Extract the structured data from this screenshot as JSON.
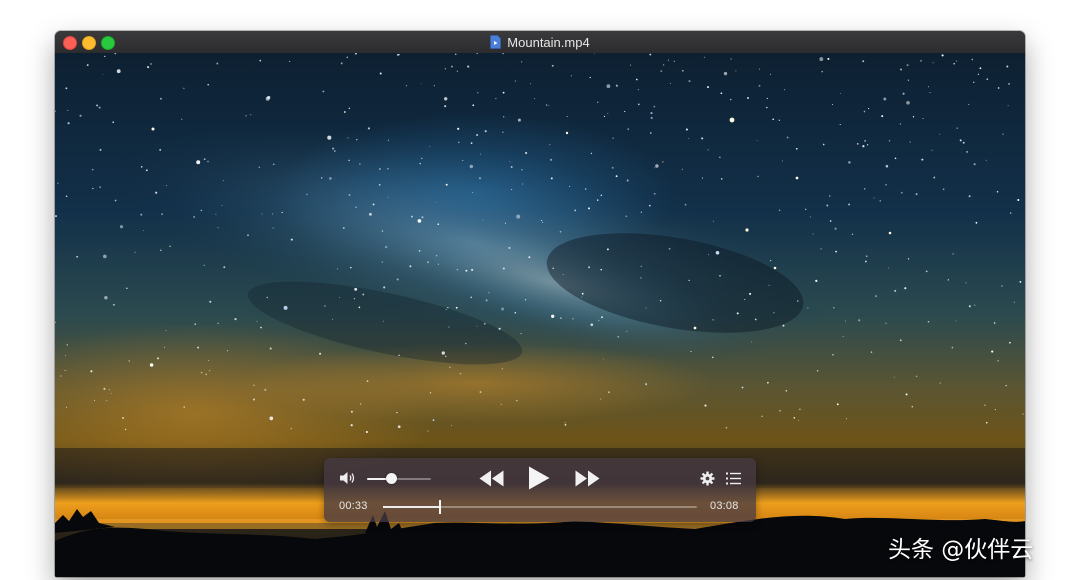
{
  "window": {
    "title": "Mountain.mp4",
    "icons": [
      "close-icon",
      "minimize-icon",
      "zoom-icon",
      "video-file-icon"
    ]
  },
  "video": {
    "scene": "night-sky"
  },
  "controls": {
    "volume_level": 0.38,
    "elapsed": "00:33",
    "duration": "03:08",
    "progress": 0.18,
    "icons": [
      "volume-icon",
      "rewind-icon",
      "play-icon",
      "fast-forward-icon",
      "settings-icon",
      "chapter-list-icon"
    ]
  },
  "watermark": {
    "text": "头条 @伙伴云"
  },
  "colors": {
    "close": "#fe5f57",
    "minimize": "#febc2e",
    "zoom": "#28c840",
    "hud": "#463a42"
  }
}
